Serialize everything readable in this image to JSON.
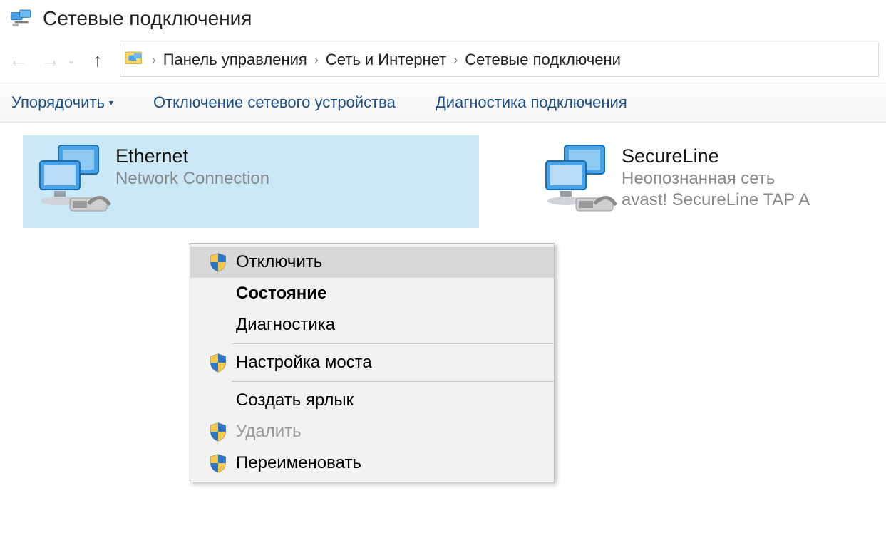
{
  "window": {
    "title": "Сетевые подключения"
  },
  "breadcrumb": {
    "items": [
      "Панель управления",
      "Сеть и Интернет",
      "Сетевые подключени"
    ]
  },
  "toolbar": {
    "organize": "Упорядочить",
    "disable_device": "Отключение сетевого устройства",
    "diagnose": "Диагностика подключения"
  },
  "connections": [
    {
      "name": "Ethernet",
      "status": "Network Connection",
      "adapter": "",
      "selected": true
    },
    {
      "name": "SecureLine",
      "status": "Неопознанная сеть",
      "adapter": "avast! SecureLine TAP A",
      "selected": false
    }
  ],
  "context_menu": {
    "items": [
      {
        "label": "Отключить",
        "shield": true,
        "hovered": true,
        "bold": false,
        "disabled": false
      },
      {
        "label": "Состояние",
        "shield": false,
        "hovered": false,
        "bold": true,
        "disabled": false
      },
      {
        "label": "Диагностика",
        "shield": false,
        "hovered": false,
        "bold": false,
        "disabled": false
      },
      {
        "divider": true
      },
      {
        "label": "Настройка моста",
        "shield": true,
        "hovered": false,
        "bold": false,
        "disabled": false
      },
      {
        "divider": true
      },
      {
        "label": "Создать ярлык",
        "shield": false,
        "hovered": false,
        "bold": false,
        "disabled": false
      },
      {
        "label": "Удалить",
        "shield": true,
        "hovered": false,
        "bold": false,
        "disabled": true
      },
      {
        "label": "Переименовать",
        "shield": true,
        "hovered": false,
        "bold": false,
        "disabled": false
      }
    ]
  }
}
